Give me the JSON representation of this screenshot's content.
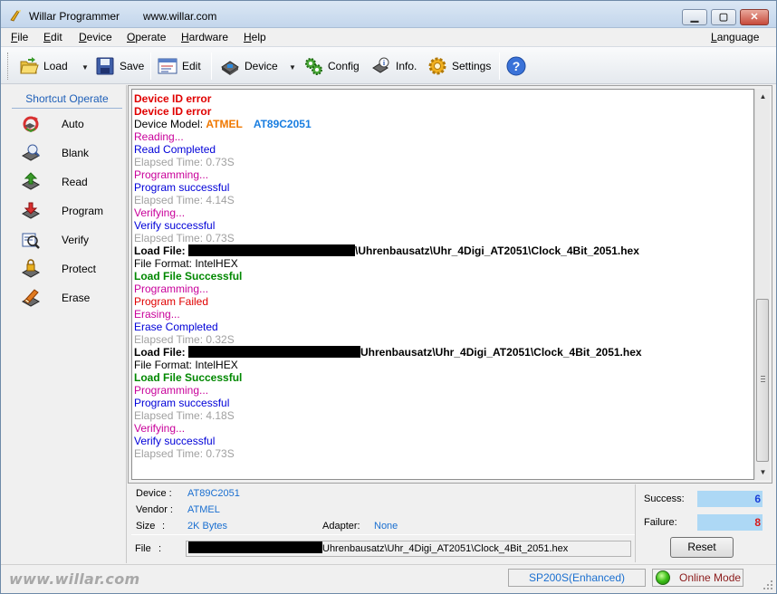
{
  "window": {
    "title": "Willar Programmer",
    "url": "www.willar.com",
    "controls": {
      "minimize": "▁",
      "maximize": "▢",
      "close": "✕"
    }
  },
  "menu": {
    "items": [
      "File",
      "Edit",
      "Device",
      "Operate",
      "Hardware",
      "Help"
    ],
    "right": "Language"
  },
  "toolbar": {
    "load": "Load",
    "save": "Save",
    "edit": "Edit",
    "device": "Device",
    "config": "Config",
    "info": "Info.",
    "settings": "Settings",
    "help_icon": "help-icon"
  },
  "sidebar": {
    "title": "Shortcut Operate",
    "items": [
      {
        "label": "Auto",
        "icon": "auto-icon"
      },
      {
        "label": "Blank",
        "icon": "blank-icon"
      },
      {
        "label": "Read",
        "icon": "read-icon"
      },
      {
        "label": "Program",
        "icon": "program-icon"
      },
      {
        "label": "Verify",
        "icon": "verify-icon"
      },
      {
        "label": "Protect",
        "icon": "protect-icon"
      },
      {
        "label": "Erase",
        "icon": "erase-icon"
      }
    ]
  },
  "log": [
    {
      "text": "Device ID error",
      "style": "c-redb"
    },
    {
      "text": "Device ID error",
      "style": "c-redb"
    },
    {
      "text": "Device Model: ",
      "style": "c-black",
      "vendor": "ATMEL",
      "model": "AT89C2051"
    },
    {
      "text": "Reading...",
      "style": "c-magenta"
    },
    {
      "text": "Read Completed",
      "style": "c-blue"
    },
    {
      "text": "Elapsed Time: 0.73S",
      "style": "c-gray"
    },
    {
      "text": "Programming...",
      "style": "c-magenta"
    },
    {
      "text": "Program successful",
      "style": "c-blue"
    },
    {
      "text": "Elapsed Time: 4.14S",
      "style": "c-gray"
    },
    {
      "text": "Verifying...",
      "style": "c-magenta"
    },
    {
      "text": "Verify successful",
      "style": "c-blue"
    },
    {
      "text": "Elapsed Time: 0.73S",
      "style": "c-gray"
    },
    {
      "text": "Load File: ",
      "style": "c-blackb",
      "redact": 184,
      "suffix": "\\Uhrenbausatz\\Uhr_4Digi_AT2051\\Clock_4Bit_2051.hex"
    },
    {
      "text": "File Format: IntelHEX",
      "style": "c-black"
    },
    {
      "text": "Load File Successful",
      "style": "c-greenb"
    },
    {
      "text": "Programming...",
      "style": "c-magenta"
    },
    {
      "text": "Program Failed",
      "style": "c-failed"
    },
    {
      "text": "Erasing...",
      "style": "c-magenta"
    },
    {
      "text": "Erase Completed",
      "style": "c-blue"
    },
    {
      "text": "Elapsed Time: 0.32S",
      "style": "c-gray"
    },
    {
      "text": "Load File: ",
      "style": "c-blackb",
      "redact": 190,
      "suffix": "Uhrenbausatz\\Uhr_4Digi_AT2051\\Clock_4Bit_2051.hex"
    },
    {
      "text": "File Format: IntelHEX",
      "style": "c-black"
    },
    {
      "text": "Load File Successful",
      "style": "c-greenb"
    },
    {
      "text": "Programming...",
      "style": "c-magenta"
    },
    {
      "text": "Program successful",
      "style": "c-blue"
    },
    {
      "text": "Elapsed Time: 4.18S",
      "style": "c-gray"
    },
    {
      "text": "Verifying...",
      "style": "c-magenta"
    },
    {
      "text": "Verify successful",
      "style": "c-blue"
    },
    {
      "text": "Elapsed Time: 0.73S",
      "style": "c-gray"
    }
  ],
  "info": {
    "device_label": "Device :",
    "device": "AT89C2051",
    "vendor_label": "Vendor :",
    "vendor": "ATMEL",
    "size_label": "Size",
    "size_colon": ":",
    "size": "2K Bytes",
    "adapter_label": "Adapter:",
    "adapter": "None",
    "file_label": "File",
    "file_colon": ":",
    "file_path": "Uhrenbausatz\\Uhr_4Digi_AT2051\\Clock_4Bit_2051.hex"
  },
  "stats": {
    "success_label": "Success:",
    "success": "6",
    "failure_label": "Failure:",
    "failure": "8",
    "reset": "Reset"
  },
  "status": {
    "brand": "www.willar.com",
    "programmer": "SP200S(Enhanced)",
    "mode": "Online Mode"
  }
}
